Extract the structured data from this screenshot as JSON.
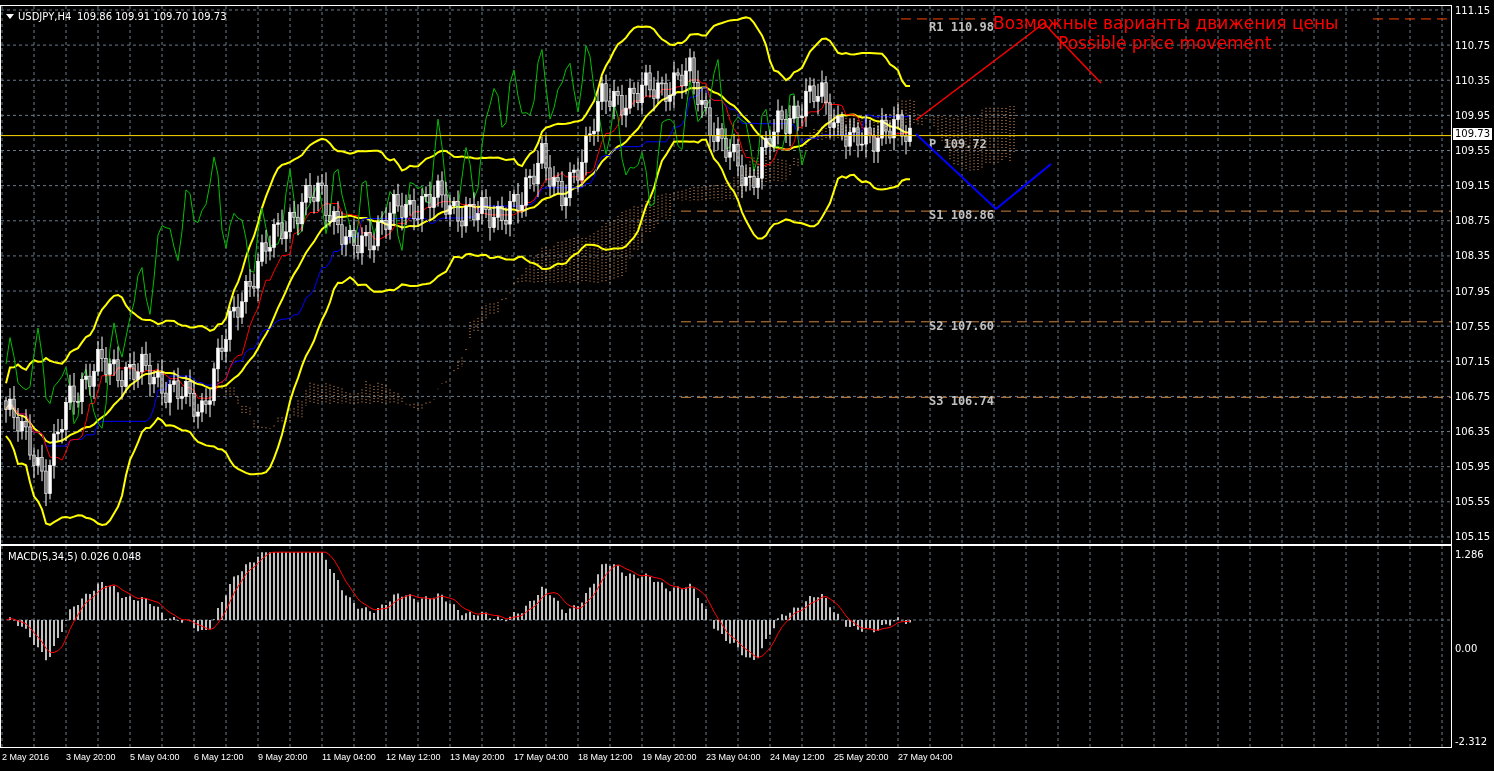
{
  "header": {
    "symbol": "USDJPY,H4",
    "ohlc": "109.86 109.91 109.70 109.73"
  },
  "price_axis": {
    "ticks": [
      "111.15",
      "110.75",
      "110.35",
      "109.95",
      "109.55",
      "109.15",
      "108.75",
      "108.35",
      "107.95",
      "107.55",
      "107.15",
      "106.75",
      "106.35",
      "105.95",
      "105.55",
      "105.15"
    ],
    "current_price": "109.73"
  },
  "levels": [
    {
      "kind": "resistance",
      "label": "R1 110.98"
    },
    {
      "kind": "pivot",
      "label": "P 109.72"
    },
    {
      "kind": "support",
      "label": "S1 108.86"
    },
    {
      "kind": "support",
      "label": "S2 107.60"
    },
    {
      "kind": "support",
      "label": "S3 106.74"
    }
  ],
  "annotation": {
    "lines": [
      "Возможные варианты движения цены",
      "Possible price movement"
    ]
  },
  "macd": {
    "label": "MACD(5,34,5) 0.026 0.048",
    "ticks": [
      "1.286",
      "0.00",
      "-2.312"
    ]
  },
  "time_axis": {
    "labels": [
      "2 May 2016",
      "3 May 20:00",
      "5 May 04:00",
      "6 May 12:00",
      "9 May 20:00",
      "11 May 04:00",
      "12 May 12:00",
      "13 May 20:00",
      "17 May 04:00",
      "18 May 12:00",
      "19 May 20:00",
      "23 May 04:00",
      "24 May 12:00",
      "25 May 20:00",
      "27 May 04:00"
    ]
  }
}
